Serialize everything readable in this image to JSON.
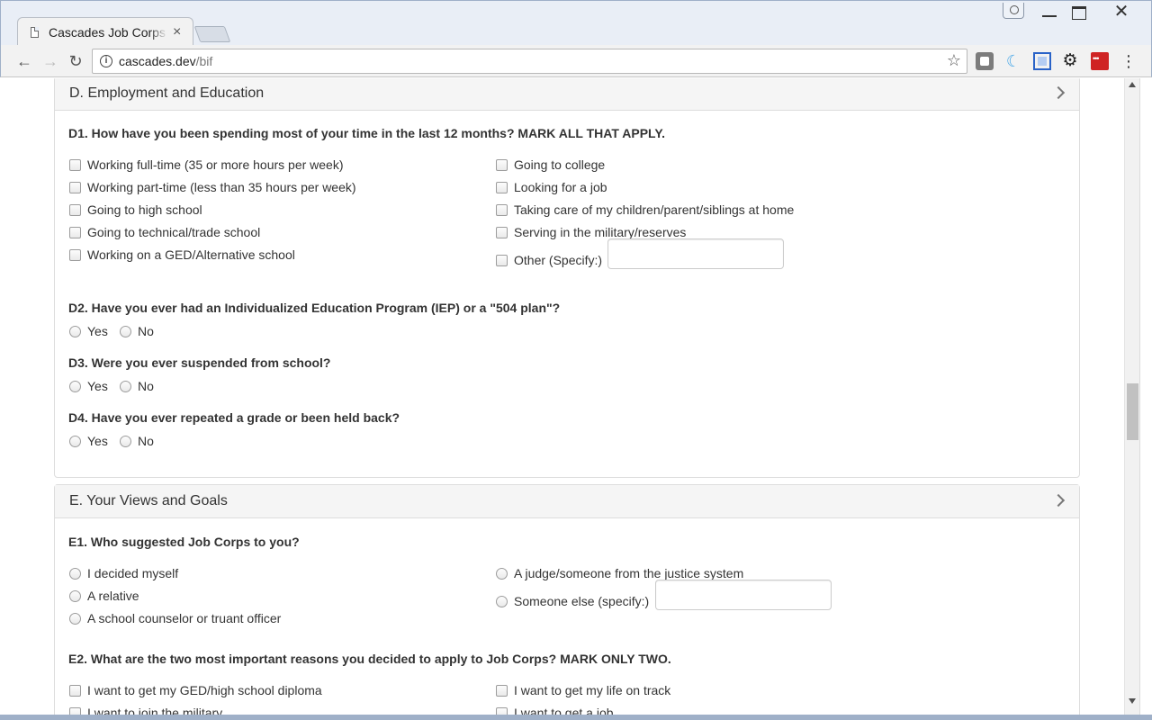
{
  "browser": {
    "tab_title": "Cascades Job Corps",
    "tab_close": "×",
    "url_host": "cascades.dev",
    "url_path": "/bif"
  },
  "section_d": {
    "title": "D. Employment and Education",
    "d1": {
      "question": "D1. How have you been spending most of your time in the last 12 months? MARK ALL THAT APPLY.",
      "left_options": [
        "Working full-time (35 or more hours per week)",
        "Working part-time (less than 35 hours per week)",
        "Going to high school",
        "Going to technical/trade school",
        "Working on a GED/Alternative school"
      ],
      "right_options": [
        "Going to college",
        "Looking for a job",
        "Taking care of my children/parent/siblings at home",
        "Serving in the military/reserves",
        "Other (Specify:)"
      ],
      "other_value": ""
    },
    "d2": {
      "question": "D2. Have you ever had an Individualized Education Program (IEP) or a \"504 plan\"?",
      "yes": "Yes",
      "no": "No"
    },
    "d3": {
      "question": "D3. Were you ever suspended from school?",
      "yes": "Yes",
      "no": "No"
    },
    "d4": {
      "question": "D4. Have you ever repeated a grade or been held back?",
      "yes": "Yes",
      "no": "No"
    }
  },
  "section_e": {
    "title": "E. Your Views and Goals",
    "e1": {
      "question": "E1. Who suggested Job Corps to you?",
      "left_options": [
        "I decided myself",
        "A relative",
        "A school counselor or truant officer"
      ],
      "right_options": [
        "A judge/someone from the justice system",
        "Someone else (specify:)"
      ],
      "other_value": ""
    },
    "e2": {
      "question": "E2. What are the two most important reasons you decided to apply to Job Corps? MARK ONLY TWO.",
      "left_options": [
        "I want to get my GED/high school diploma",
        "I want to join the military"
      ],
      "right_options": [
        "I want to get my life on track",
        "I want to get a job"
      ]
    }
  }
}
